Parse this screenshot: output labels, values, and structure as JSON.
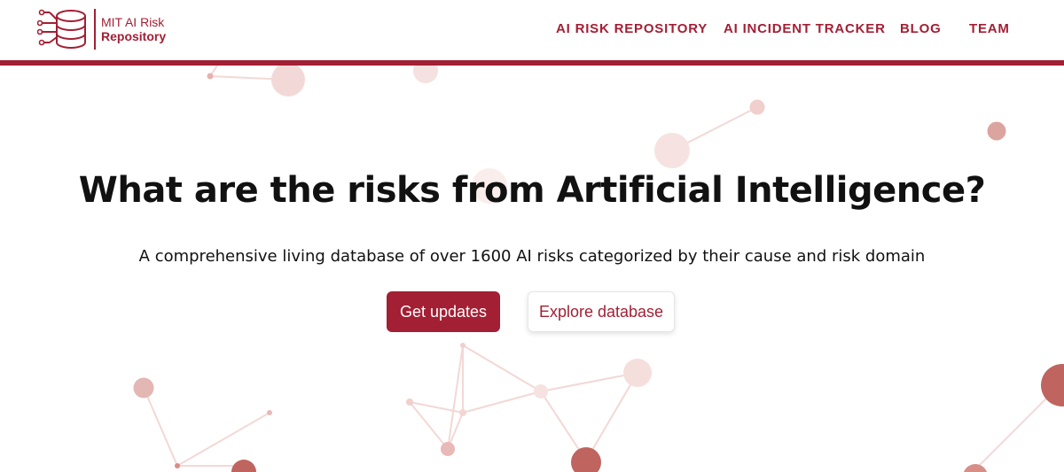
{
  "brand": {
    "line1": "MIT AI Risk",
    "line2": "Repository",
    "icon": "database-circuit-icon",
    "color": "#a31f34"
  },
  "nav": {
    "items": [
      {
        "label": "AI RISK REPOSITORY"
      },
      {
        "label": "AI INCIDENT TRACKER"
      },
      {
        "label": "BLOG"
      },
      {
        "label": "TEAM"
      }
    ]
  },
  "hero": {
    "title": "What are the risks from Artificial Intelligence?",
    "subtitle": "A comprehensive living database of over 1600 AI risks categorized by their cause and risk domain",
    "primary_button": "Get updates",
    "secondary_button": "Explore database"
  },
  "colors": {
    "accent": "#a31f34",
    "node": "#c0645f",
    "text": "#111111",
    "background": "#ffffff"
  }
}
